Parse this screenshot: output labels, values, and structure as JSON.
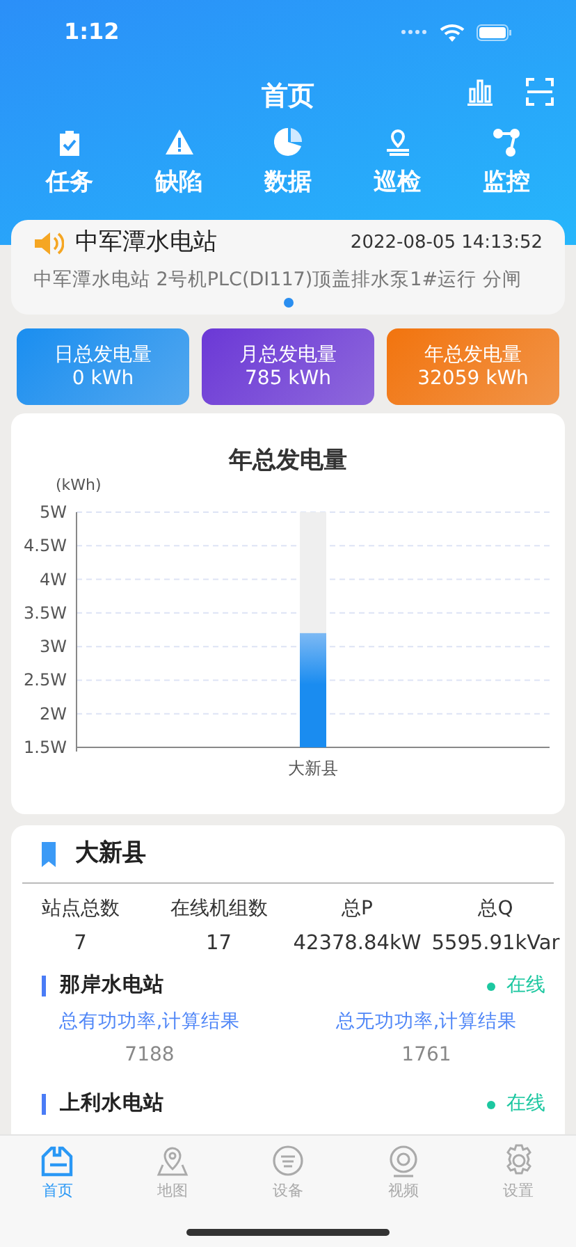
{
  "status_bar": {
    "time": "1:12"
  },
  "header": {
    "title": "首页"
  },
  "quick_menu": [
    {
      "label": "任务"
    },
    {
      "label": "缺陷"
    },
    {
      "label": "数据"
    },
    {
      "label": "巡检"
    },
    {
      "label": "监控"
    }
  ],
  "notice": {
    "station": "中军潭水电站",
    "time": "2022-08-05 14:13:52",
    "message": "中军潭水电站 2号机PLC(DI117)顶盖排水泵1#运行 分闸"
  },
  "energy_cards": [
    {
      "label": "日总发电量",
      "value": "0 kWh",
      "color": "#1a8ef0"
    },
    {
      "label": "月总发电量",
      "value": "785 kWh",
      "color": "#6b38d6"
    },
    {
      "label": "年总发电量",
      "value": "32059 kWh",
      "color": "#f2740e"
    }
  ],
  "chart": {
    "chart_data": {
      "type": "bar",
      "title": "年总发电量",
      "ylabel": "(kWh)",
      "categories": [
        "大新县"
      ],
      "values": [
        3.2
      ],
      "grid": true,
      "ylim": [
        1.5,
        5
      ],
      "yticks": [
        {
          "value": 1.5,
          "label": "1.5W"
        },
        {
          "value": 2,
          "label": "2W"
        },
        {
          "value": 2.5,
          "label": "2.5W"
        },
        {
          "value": 3,
          "label": "3W"
        },
        {
          "value": 3.5,
          "label": "3.5W"
        },
        {
          "value": 4,
          "label": "4W"
        },
        {
          "value": 4.5,
          "label": "4.5W"
        },
        {
          "value": 5,
          "label": "5W"
        }
      ]
    }
  },
  "district": {
    "name": "大新县",
    "stats": [
      {
        "label": "站点总数",
        "value": "7"
      },
      {
        "label": "在线机组数",
        "value": "17"
      },
      {
        "label": "总P",
        "value": "42378.84kW"
      },
      {
        "label": "总Q",
        "value": "5595.91kVar"
      }
    ],
    "stations": [
      {
        "name": "那岸水电站",
        "status": "在线",
        "online": true,
        "metrics": [
          {
            "label": "总有功功率,计算结果",
            "value": "7188"
          },
          {
            "label": "总无功功率,计算结果",
            "value": "1761"
          }
        ]
      },
      {
        "name": "上利水电站",
        "status": "在线",
        "online": true
      }
    ]
  },
  "tab_bar": [
    {
      "label": "首页",
      "selected": true
    },
    {
      "label": "地图",
      "selected": false
    },
    {
      "label": "设备",
      "selected": false
    },
    {
      "label": "视频",
      "selected": false
    },
    {
      "label": "设置",
      "selected": false
    }
  ]
}
